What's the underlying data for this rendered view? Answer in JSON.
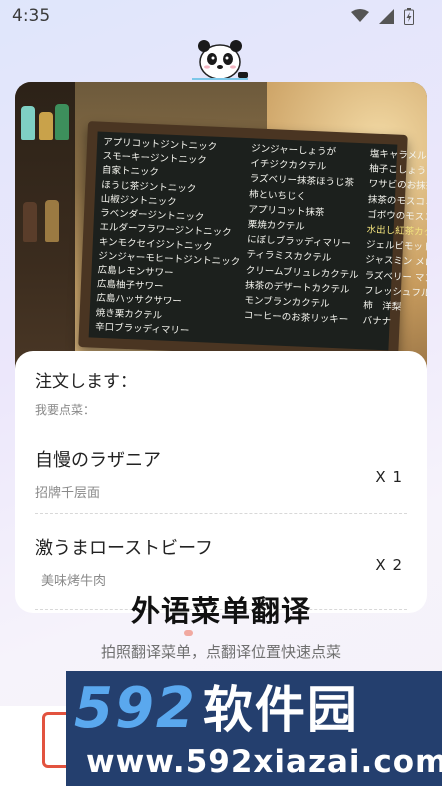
{
  "status_bar": {
    "time": "4:35",
    "icons": [
      "wifi-icon",
      "signal-icon",
      "battery-icon"
    ]
  },
  "mascot": "panda-icon",
  "menu_board": {
    "left_column": [
      "アプリコットジントニック",
      "スモーキージントニック",
      "自家トニック",
      "ほうじ茶ジントニック",
      "山椒ジントニック",
      "ラベンダージントニック",
      "エルダーフラワージントニック",
      "キンモクセイジントニック",
      "ジンジャーモヒートジントニック",
      "広島レモンサワー",
      "広島柚子サワー",
      "広島ハッサクサワー",
      "焼き栗カクテル",
      "辛口ブラッディマリー"
    ],
    "middle_column": [
      "ジンジャーしょうが",
      "イチジクカクテル",
      "ラズベリー抹茶ほうじ茶",
      "柿といちじく",
      "アプリコット抹茶",
      "栗焼カクテル",
      "にぼしブラッディマリー",
      "ティラミスカクテル",
      "クリームブリュレカクテル",
      "抹茶のデザートカクテル",
      "モンブランカクテル",
      "コーヒーのお茶リッキー"
    ],
    "right_column": [
      "塩キャラメルカクテル",
      "柚子こしょうハイボール",
      "ワサビのお抹茶カクテル",
      "抹茶のモスコミュール",
      "ゴボウのモスコミュール",
      "水出し紅茶カクテル",
      "ジェルビモット",
      "ジャスミン メロン",
      "ラズベリー マンゴー",
      "フレッシュフルーツカクテル",
      "柿　洋梨",
      "バナナ"
    ]
  },
  "order": {
    "title": "注文します：",
    "subtitle": "我要点菜：",
    "items": [
      {
        "name": "自慢のラザニア",
        "translation": "招牌千层面",
        "qty": "X 1"
      },
      {
        "name": "激うまローストビーフ",
        "translation": "美味烤牛肉",
        "qty": "X 2"
      }
    ]
  },
  "feature": {
    "title": "外语菜单翻译",
    "description": "拍照翻译菜单，点翻译位置快速点菜"
  },
  "watermark": {
    "digits": "592",
    "brand": "软件园",
    "url": "www.592xiazai.com"
  },
  "colors": {
    "accent": "#e2533f",
    "watermark_bg": "#243f6e",
    "watermark_digits": "#5aa8ee"
  }
}
